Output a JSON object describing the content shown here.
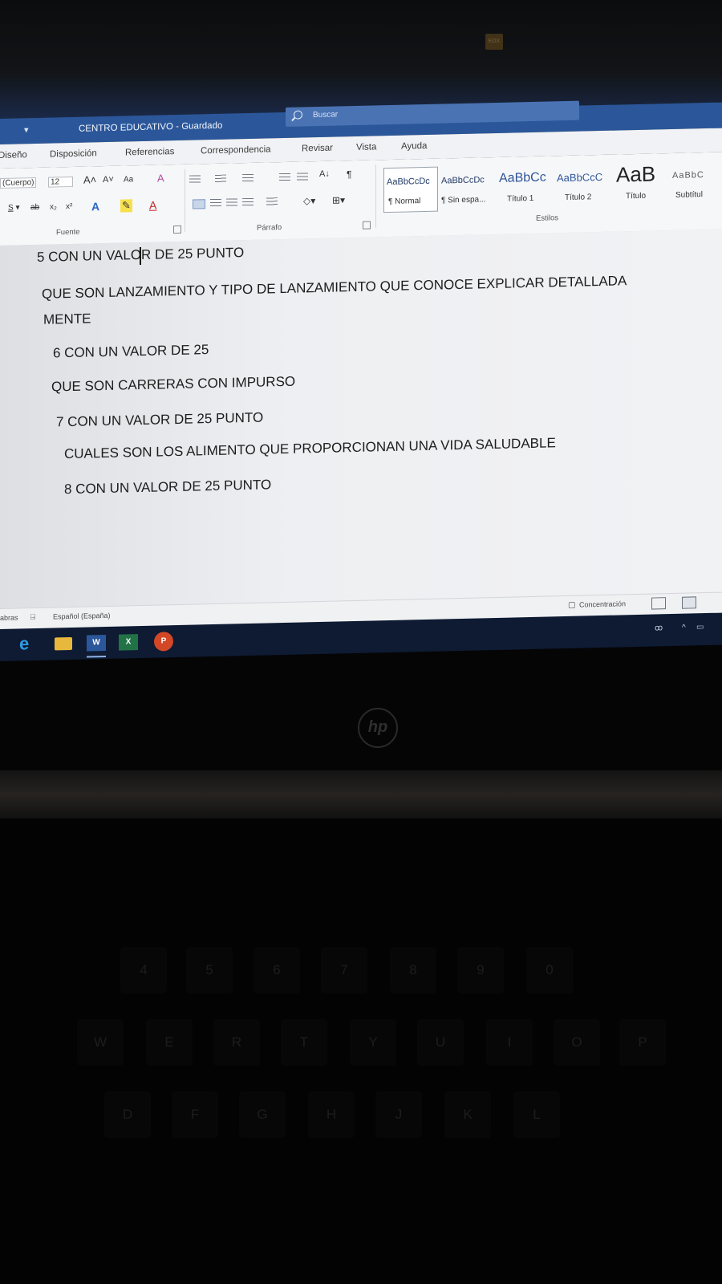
{
  "word": {
    "title": "CENTRO EDUCATIVO  -  Guardado",
    "search_label": "Buscar",
    "tabs": [
      "Diseño",
      "Disposición",
      "Referencias",
      "Correspondencia",
      "Revisar",
      "Vista",
      "Ayuda"
    ],
    "font": {
      "name": "(Cuerpo)",
      "size": "12",
      "change_case": "Aa",
      "group_label": "Fuente"
    },
    "paragraph": {
      "group_label": "Párrafo"
    },
    "styles": {
      "items": [
        {
          "sample": "AaBbCcDc",
          "name": "¶ Normal"
        },
        {
          "sample": "AaBbCcDc",
          "name": "¶ Sin espa..."
        },
        {
          "sample": "AaBbCc",
          "name": "Título 1"
        },
        {
          "sample": "AaBbCcC",
          "name": "Título 2"
        },
        {
          "sample": "AaB",
          "name": "Título"
        },
        {
          "sample": "AaBbC",
          "name": "Subtítul"
        }
      ],
      "group_label": "Estilos"
    },
    "document_lines": [
      "5 CON UN VALOR DE 25 PUNTO",
      "QUE SON LANZAMIENTO Y TIPO DE LANZAMIENTO QUE CONOCE EXPLICAR DETALLADA",
      "MENTE",
      "6   CON UN VALOR DE 25",
      "QUE SON CARRERAS CON IMPURSO",
      "7 CON UN VALOR DE 25 PUNTO",
      "CUALES SON LOS ALIMENTO QUE PROPORCIONAN UNA VIDA SALUDABLE",
      "8 CON UN VALOR DE 25 PUNTO"
    ],
    "status": {
      "words": "abras",
      "language": "Español (España)",
      "focus": "Concentración"
    }
  },
  "taskbar": {
    "apps": [
      "edge-icon",
      "file-explorer-icon",
      "word-icon",
      "excel-icon",
      "powerpoint-icon"
    ]
  },
  "laptop": {
    "brand": "hp",
    "keys": [
      "4",
      "5",
      "6",
      "7",
      "8",
      "9",
      "0",
      "W",
      "E",
      "R",
      "T",
      "Y",
      "U",
      "I",
      "O",
      "P",
      "D",
      "F",
      "G",
      "H",
      "J",
      "K",
      "L"
    ]
  }
}
